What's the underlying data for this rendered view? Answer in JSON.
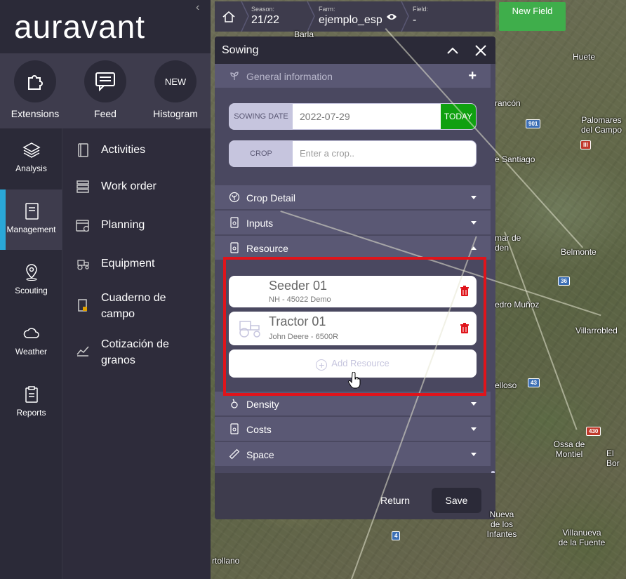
{
  "app": {
    "logo": "auravant"
  },
  "quick_actions": [
    {
      "label": "Extensions",
      "icon": "puzzle-icon"
    },
    {
      "label": "Feed",
      "icon": "chat-icon"
    },
    {
      "label": "Histogram",
      "badge": "NEW"
    }
  ],
  "nav": [
    {
      "label": "Analysis",
      "icon": "layers-icon"
    },
    {
      "label": "Management",
      "icon": "notebook-icon",
      "active": true
    },
    {
      "label": "Scouting",
      "icon": "pin-icon"
    },
    {
      "label": "Weather",
      "icon": "cloud-icon"
    },
    {
      "label": "Reports",
      "icon": "clipboard-icon"
    }
  ],
  "submenu": [
    {
      "label": "Activities",
      "icon": "book-icon"
    },
    {
      "label": "Work order",
      "icon": "stack-icon"
    },
    {
      "label": "Planning",
      "icon": "calendar-icon"
    },
    {
      "label": "Equipment",
      "icon": "tractor-icon"
    },
    {
      "label": "Cuaderno de campo",
      "icon": "field-book-icon"
    },
    {
      "label": "Cotización de granos",
      "icon": "chart-icon"
    }
  ],
  "topbar": {
    "season_caption": "Season:",
    "season_value": "21/22",
    "farm_caption": "Farm:",
    "farm_value": "ejemplo_esp",
    "field_caption": "Field:",
    "field_value": "-",
    "new_field_label": "New Field"
  },
  "dialog": {
    "title": "Sowing",
    "general_info_label": "General information",
    "sowing_date_caption": "SOWING DATE",
    "sowing_date_value": "2022-07-29",
    "today_label": "TODAY",
    "crop_caption": "CROP",
    "crop_placeholder": "Enter a crop..",
    "sections": [
      {
        "label": "Crop Detail",
        "state": "collapsed"
      },
      {
        "label": "Inputs",
        "state": "collapsed"
      },
      {
        "label": "Resource",
        "state": "expanded"
      },
      {
        "label": "Density",
        "state": "collapsed"
      },
      {
        "label": "Costs",
        "state": "collapsed"
      },
      {
        "label": "Space",
        "state": "collapsed"
      }
    ],
    "resources": [
      {
        "name": "Seeder 01",
        "detail": "NH - 45022 Demo"
      },
      {
        "name": "Tractor 01",
        "detail": "John Deere - 6500R"
      }
    ],
    "add_resource_label": "Add Resource",
    "return_label": "Return",
    "save_label": "Save"
  },
  "map_labels": [
    "Barla",
    "Huete",
    "rancón",
    "Palomares del Campo",
    "e Santiago",
    "mar de den",
    "Belmonte",
    "edro Muñoz",
    "Villarrobled",
    "elloso",
    "Ossa de Montiel",
    "El Bor",
    "Nueva de los Infantes",
    "Villanueva de la Fuente",
    "rtollano"
  ],
  "road_badges": [
    "901",
    "III",
    "36",
    "43",
    "430",
    "4"
  ],
  "colors": {
    "accent_blue": "#2aa8d8",
    "new_field_green": "#3fae4b",
    "today_green": "#10a010",
    "highlight_red": "#e0141b",
    "trash_red": "#e0141b"
  }
}
